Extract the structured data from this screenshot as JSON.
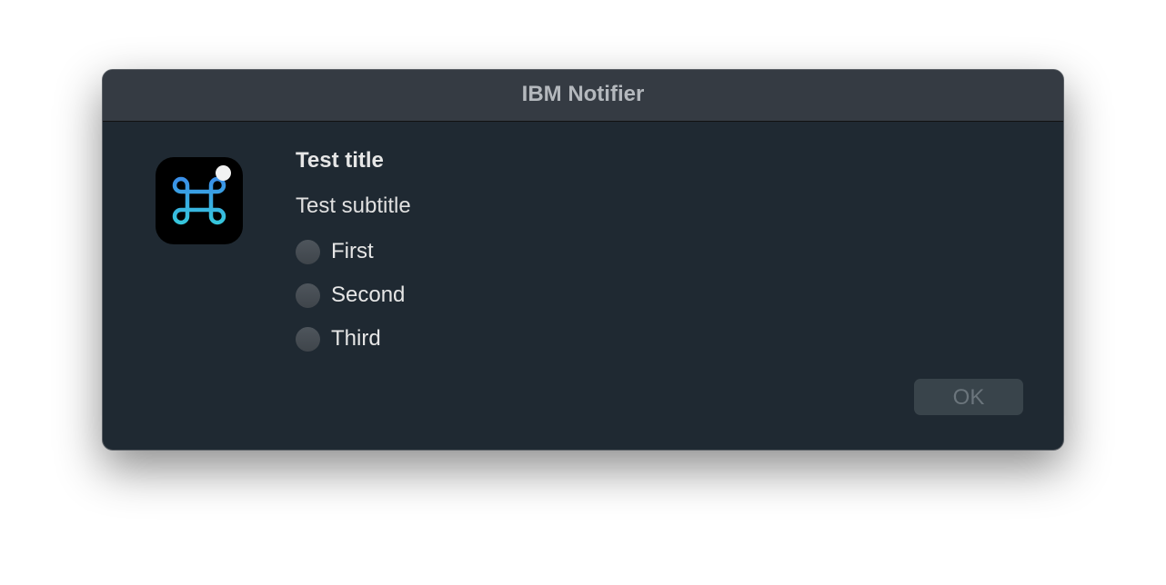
{
  "window": {
    "title": "IBM Notifier"
  },
  "content": {
    "title": "Test title",
    "subtitle": "Test subtitle",
    "options": [
      "First",
      "Second",
      "Third"
    ],
    "selected": null
  },
  "buttons": {
    "ok": "OK"
  },
  "icon": "command-key-icon"
}
